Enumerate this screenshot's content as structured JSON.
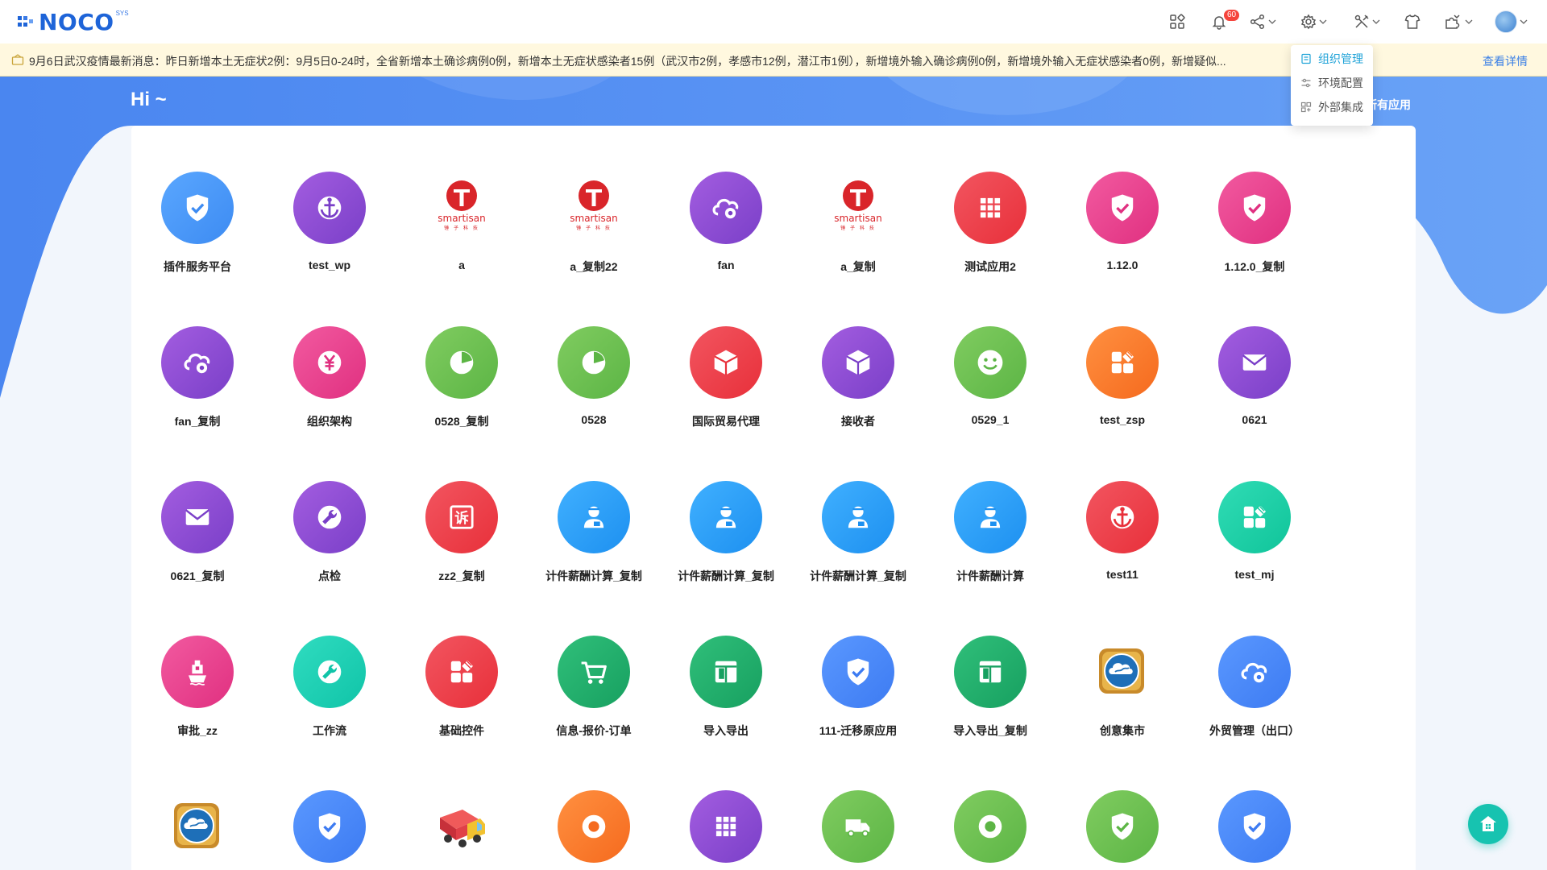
{
  "header": {
    "logo_text": "NOCO",
    "logo_sup": "SYS",
    "notification_count": "60",
    "icons": [
      "apps-grid-icon",
      "bell-icon",
      "share-icon",
      "gear-icon",
      "tools-icon",
      "shirt-icon",
      "puzzle-icon",
      "avatar"
    ]
  },
  "notice": {
    "text": "9月6日武汉疫情最新消息：昨日新增本土无症状2例：9月5日0-24时，全省新增本土确诊病例0例，新增本土无症状感染者15例（武汉市2例，孝感市12例，潜江市1例），新增境外输入确诊病例0例，新增境外输入无症状感染者0例，新增疑似...",
    "link": "查看详情"
  },
  "greeting": "Hi ~",
  "all_apps_link": "所有应用",
  "settings_menu": [
    {
      "label": "组织管理",
      "active": true
    },
    {
      "label": "环境配置",
      "active": false
    },
    {
      "label": "外部集成",
      "active": false
    }
  ],
  "apps": [
    {
      "label": "插件服务平台",
      "icon": "shield-check-icon",
      "color": "#3d8bf2",
      "color2": "#5aa7ff"
    },
    {
      "label": "test_wp",
      "icon": "anchor-icon",
      "color": "#7a3fc8",
      "color2": "#a35de0"
    },
    {
      "label": "a",
      "icon": "smartisan-logo",
      "color": "#d9252a",
      "color2": "#d9252a"
    },
    {
      "label": "a_复制22",
      "icon": "smartisan-logo",
      "color": "#d9252a",
      "color2": "#d9252a"
    },
    {
      "label": "fan",
      "icon": "cloud-gear-icon",
      "color": "#7a3fc8",
      "color2": "#a35de0"
    },
    {
      "label": "a_复制",
      "icon": "smartisan-logo",
      "color": "#d9252a",
      "color2": "#d9252a"
    },
    {
      "label": "测试应用2",
      "icon": "grid-icon",
      "color": "#e8303a",
      "color2": "#f25560"
    },
    {
      "label": "1.12.0",
      "icon": "shield-check-icon",
      "color": "#e03080",
      "color2": "#f25aa0"
    },
    {
      "label": "1.12.0_复制",
      "icon": "shield-check-icon",
      "color": "#e03080",
      "color2": "#f25aa0"
    },
    {
      "label": "fan_复制",
      "icon": "cloud-gear-icon",
      "color": "#7a3fc8",
      "color2": "#a35de0"
    },
    {
      "label": "组织架构",
      "icon": "yen-icon",
      "color": "#e03080",
      "color2": "#f25aa0"
    },
    {
      "label": "0528_复制",
      "icon": "pie-chart-icon",
      "color": "#5cb545",
      "color2": "#80cc60"
    },
    {
      "label": "0528",
      "icon": "pie-chart-icon",
      "color": "#5cb545",
      "color2": "#80cc60"
    },
    {
      "label": "国际贸易代理",
      "icon": "box-icon",
      "color": "#e8303a",
      "color2": "#f25560"
    },
    {
      "label": "接收者",
      "icon": "box-icon",
      "color": "#7a3fc8",
      "color2": "#a35de0"
    },
    {
      "label": "0529_1",
      "icon": "smile-icon",
      "color": "#5cb545",
      "color2": "#80cc60"
    },
    {
      "label": "test_zsp",
      "icon": "blocks-icon",
      "color": "#f56a1e",
      "color2": "#ff9040"
    },
    {
      "label": "0621",
      "icon": "mail-icon",
      "color": "#7a3fc8",
      "color2": "#a35de0"
    },
    {
      "label": "0621_复制",
      "icon": "mail-icon",
      "color": "#7a3fc8",
      "color2": "#a35de0"
    },
    {
      "label": "点检",
      "icon": "wrench-icon",
      "color": "#7a3fc8",
      "color2": "#a35de0"
    },
    {
      "label": "zz2_复制",
      "icon": "su-icon",
      "color": "#e8303a",
      "color2": "#f25560"
    },
    {
      "label": "计件薪酬计算_复制",
      "icon": "person-card-icon",
      "color": "#1d90f0",
      "color2": "#40b0ff"
    },
    {
      "label": "计件薪酬计算_复制",
      "icon": "person-card-icon",
      "color": "#1d90f0",
      "color2": "#40b0ff"
    },
    {
      "label": "计件薪酬计算_复制",
      "icon": "person-card-icon",
      "color": "#1d90f0",
      "color2": "#40b0ff"
    },
    {
      "label": "计件薪酬计算",
      "icon": "person-card-icon",
      "color": "#1d90f0",
      "color2": "#40b0ff"
    },
    {
      "label": "test11",
      "icon": "anchor-icon",
      "color": "#e8303a",
      "color2": "#f25560"
    },
    {
      "label": "test_mj",
      "icon": "blocks-icon",
      "color": "#10c49a",
      "color2": "#30dcb5"
    },
    {
      "label": "审批_zz",
      "icon": "ship-icon",
      "color": "#e03080",
      "color2": "#f25aa0"
    },
    {
      "label": "工作流",
      "icon": "wrench-icon",
      "color": "#10c4a8",
      "color2": "#30dcc0"
    },
    {
      "label": "基础控件",
      "icon": "blocks-icon",
      "color": "#e8303a",
      "color2": "#f25560"
    },
    {
      "label": "信息-报价-订单",
      "icon": "cart-icon",
      "color": "#17a060",
      "color2": "#30bf7a"
    },
    {
      "label": "导入导出",
      "icon": "layout-icon",
      "color": "#17a060",
      "color2": "#30bf7a"
    },
    {
      "label": "111-迁移原应用",
      "icon": "shield-check-icon",
      "color": "#3d7bf2",
      "color2": "#5a98ff"
    },
    {
      "label": "导入导出_复制",
      "icon": "layout-icon",
      "color": "#17a060",
      "color2": "#30bf7a"
    },
    {
      "label": "创意集市",
      "icon": "cloud-badge-image",
      "color": "#c88a2a",
      "color2": "#e6a840"
    },
    {
      "label": "外贸管理（出口）",
      "icon": "cloud-gear-icon",
      "color": "#3d7bf2",
      "color2": "#5a98ff"
    },
    {
      "label": "",
      "icon": "cloud-badge-image",
      "color": "#c88a2a",
      "color2": "#e6a840"
    },
    {
      "label": "",
      "icon": "shield-check-icon",
      "color": "#3d7bf2",
      "color2": "#5a98ff"
    },
    {
      "label": "",
      "icon": "truck-image",
      "color": "#e8303a",
      "color2": "#f25560"
    },
    {
      "label": "",
      "icon": "ring-icon",
      "color": "#f56a1e",
      "color2": "#ff9040"
    },
    {
      "label": "",
      "icon": "grid-icon",
      "color": "#7a3fc8",
      "color2": "#a35de0"
    },
    {
      "label": "",
      "icon": "truck-icon",
      "color": "#5cb545",
      "color2": "#80cc60"
    },
    {
      "label": "",
      "icon": "ring-icon",
      "color": "#5cb545",
      "color2": "#80cc60"
    },
    {
      "label": "",
      "icon": "shield-check-icon",
      "color": "#5cb545",
      "color2": "#80cc60"
    },
    {
      "label": "",
      "icon": "shield-check-icon",
      "color": "#3d7bf2",
      "color2": "#5a98ff"
    }
  ]
}
